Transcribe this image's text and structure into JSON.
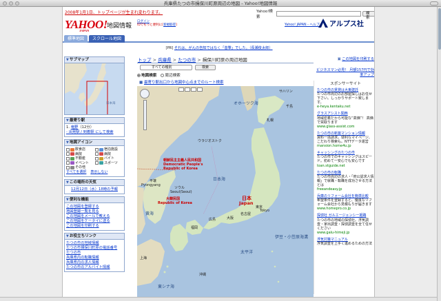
{
  "window": {
    "title": "兵庫県たつの市揖保川町原周辺の地図 - Yahoo!地図情報"
  },
  "header": {
    "news": "2008年1月1日、トップページが生まれ変わります。",
    "search_label": "Yahoo!検索",
    "search_button": "検索",
    "logo": "YAHOO!",
    "logo_sub": "JAPAN",
    "service": "地図情報",
    "beta_line1": "ログイン",
    "beta_line2": "IDでもっと便利に[",
    "beta_link": "新規取得",
    "beta_end": "]",
    "top_links": "Yahoo! JAPAN - ヘルプ",
    "partner": "アルプス社"
  },
  "tabs": [
    {
      "label": "標準地図"
    },
    {
      "label": "スクロール地図"
    }
  ],
  "pr": {
    "prefix": "[PR]",
    "text": "それは、がんの告知ではなく「昔撃」でした。（長瀬俊太郎）"
  },
  "sidebar": {
    "submap": {
      "title": "サブマップ",
      "sea": "日本海"
    },
    "station": {
      "title": "最寄り駅",
      "item_no": "1.",
      "station": "竜野",
      "minutes": "（12分）",
      "sub": "- 出発駅 / 到着駅 にして検索"
    },
    "icons": {
      "title": "地図アイコン",
      "items": [
        {
          "label": "飲食店",
          "color": "#e8793a"
        },
        {
          "label": "宿泊施設",
          "color": "#5a8fd6"
        },
        {
          "label": "病院",
          "color": "#d64a4a"
        },
        {
          "label": "病院",
          "color": "#d64a4a"
        },
        {
          "label": "不動産",
          "color": "#5aa05a"
        },
        {
          "label": "バイト",
          "color": "#caa12d"
        },
        {
          "label": "イベント",
          "color": "#9a59c4"
        },
        {
          "label": "スポーツ",
          "color": "#3ba3a3"
        },
        {
          "label": "その他",
          "color": "#888888"
        }
      ],
      "check_all": "すべてを選択",
      "clear": "表示しない"
    },
    "weather": {
      "title": "この場所の天気",
      "text": "12月12日（水）18時の予報"
    },
    "tools": {
      "title": "便利な機能",
      "items": [
        "この地図を登録する",
        "地図登録一覧を見る",
        "この地図をメールで教える",
        "この地図をケータイに送る",
        "この地図を印刷する"
      ]
    },
    "osusume": {
      "title": "お役立ちリンク",
      "items": [
        "たつの市の地域情報",
        "たつの市揖保川町原の電話番号",
        "たつの市",
        "兵庫県内の転職情報",
        "兵庫県内の求人情報",
        "たつの市のアルバイト情報"
      ]
    }
  },
  "center": {
    "breadcrumb": [
      {
        "label": "トップ",
        "link": true
      },
      {
        "label": "兵庫県",
        "link": true
      },
      {
        "label": "たつの市",
        "link": true
      },
      {
        "label": "揖保川町原の周辺地図",
        "link": false
      }
    ],
    "select": "すべての種別",
    "search_button": "検索",
    "radio_map": "地図検索",
    "radio_area": "周辺検索",
    "route": "最寄り駅出口から地図中心点までのルート検索"
  },
  "map": {
    "labels": {
      "sea_japan": "日本海",
      "sea_ohotsk": "オホーツク海",
      "pacific": "太平洋",
      "east_china": "東シナ海",
      "yellow": "黄海",
      "korea_east": "朝鮮民主主義人民共和国",
      "korea_east_en1": "Democratic People's",
      "korea_east_en2": "Republic of Korea",
      "korea_south": "大韓民国",
      "korea_south_en": "Republic of Korea",
      "japan_jp": "日本",
      "japan_en": "Japan",
      "seoul": "ソウル",
      "seoul_en": "Seoul(Seoul)",
      "pyongyang": "平壌",
      "pyongyang_en": "Pyongyang",
      "tokyo": "東京",
      "tokyo_en": "Tokyo",
      "osaka": "大阪",
      "vladivostok": "ウラジオストク",
      "sapporo": "札幌",
      "kuril": "千島",
      "sakhalin": "サハリン",
      "ogasawara": "伊豆・小笠原海溝",
      "nagoya": "名古屋",
      "fukuoka": "福岡",
      "shanghai": "上海",
      "okinawa": "沖縄",
      "hiroshima": "広島"
    }
  },
  "right": {
    "link1": "この地図を印刷する",
    "link2": "ビジネスマン必見！ 月額157円で効率アップ",
    "sponsor_title": "スポンサーサイト",
    "ads": [
      {
        "title": "たつの市の賃貸は大東建託",
        "body": "たつの市周辺のお部屋探しはお任せ下さい。しっかりサポート致します。",
        "url": "e-heya.kentaku.net"
      },
      {
        "title": "グラスアシスト関西",
        "body": "地域密着だから可能な“高価”！ 高価で買取ります",
        "url": "www.glass-assist.com"
      },
      {
        "title": "たつの市の新築マンション情報",
        "body": "資料一括請求。便利なマイページ、こだわり検索も。NTTデータ運営",
        "url": "mansion.home4u.jp"
      },
      {
        "title": "キャッシングのたつの市",
        "body": "たつの市でのキャッシングはスピード。初めて一安心でも安心です",
        "url": "loan.stguide.net"
      },
      {
        "title": "たつの市の転職",
        "body": "たつの市周辺の求人・「府公認求人情報」で就職・転職を成功させる方法とは",
        "url": "freeandeasy.jp"
      },
      {
        "title": "兵庫のリフォーム会社を簡単比較",
        "body": "希望条件を登録すると、優良なリフォーム会社から見積もりが届きます",
        "url": "www.homepro.co.jp"
      },
      {
        "title": "探偵社 ガルエージェンシー姫路",
        "body": "たつの市の地域の探偵社。浮気調査・家出調査・探偵調査を全て任せください",
        "url": "www.galu-himeji.jp"
      },
      {
        "title": "浮気対策マニュアル",
        "body": "浮気調査を上手く進めるための方法",
        "url": ""
      }
    ]
  }
}
